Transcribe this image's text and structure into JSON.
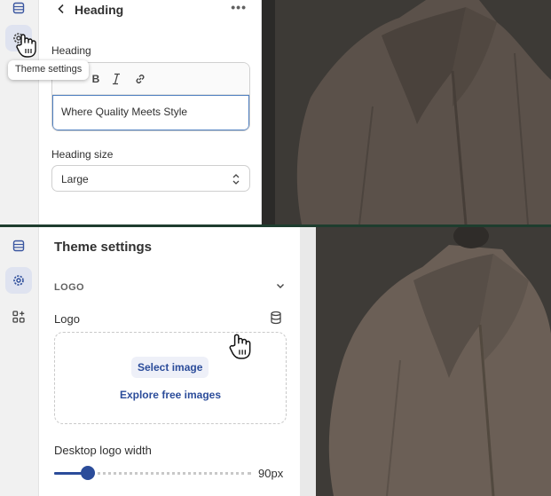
{
  "top_frame": {
    "header": {
      "title": "Heading"
    },
    "tooltip": "Theme settings",
    "heading_field": {
      "label": "Heading",
      "value": "Where Quality Meets Style"
    },
    "heading_size": {
      "label": "Heading size",
      "selected": "Large"
    }
  },
  "bottom_frame": {
    "panel_title": "Theme settings",
    "section": {
      "label": "LOGO"
    },
    "logo": {
      "label": "Logo",
      "select_button": "Select image",
      "explore_link": "Explore free images"
    },
    "desktop_logo_width": {
      "label": "Desktop logo width",
      "value_text": "90px",
      "slider_fraction": 0.17
    }
  },
  "colors": {
    "accent": "#2b4c9a",
    "focus_border": "#4f7fc0",
    "rail_active": "#dfe3f0",
    "preview_coat": "#6e6259"
  },
  "icons": [
    "sections-icon",
    "gear-icon",
    "apps-icon",
    "back-chevron-icon",
    "more-icon",
    "italic-icon",
    "link-icon",
    "select-chevron-icon",
    "chevron-down-icon",
    "database-icon",
    "hand-cursor-icon"
  ]
}
